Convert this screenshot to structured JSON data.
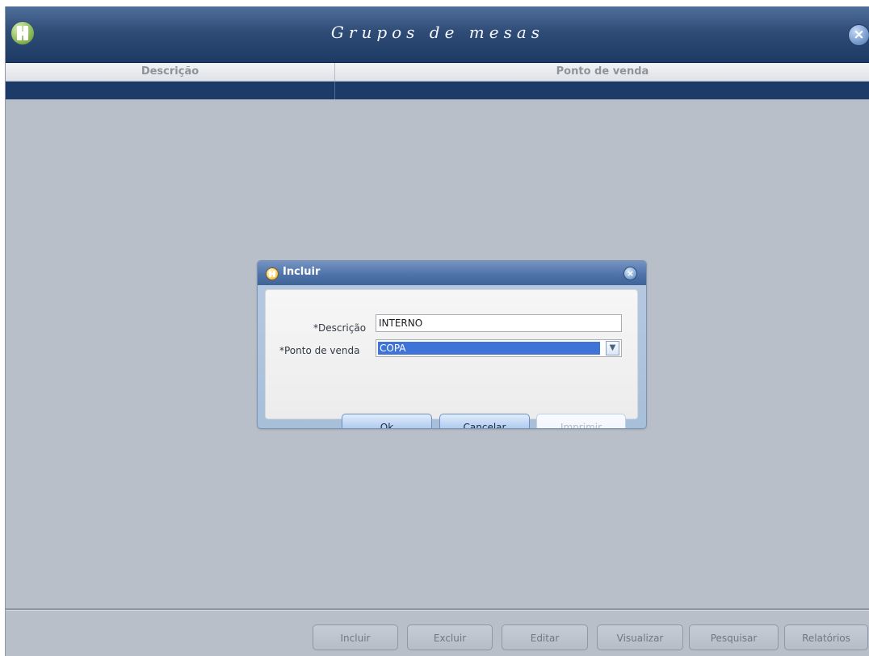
{
  "window": {
    "title": "Grupos de mesas",
    "close_icon": "close-icon"
  },
  "grid": {
    "columns": [
      "Descrição",
      "Ponto de venda"
    ],
    "rows": [
      [
        "",
        ""
      ]
    ]
  },
  "dialog": {
    "title": "Incluir",
    "fields": {
      "descricao_label": "*Descrição",
      "descricao_value": "INTERNO",
      "ponto_label": "*Ponto de venda",
      "ponto_value": "COPA"
    },
    "buttons": {
      "ok": "Ok",
      "cancelar": "Cancelar",
      "imprimir": "Imprimir"
    }
  },
  "footer": {
    "buttons": [
      "Incluir",
      "Excluir",
      "Editar",
      "Visualizar",
      "Pesquisar",
      "Relatórios"
    ]
  }
}
